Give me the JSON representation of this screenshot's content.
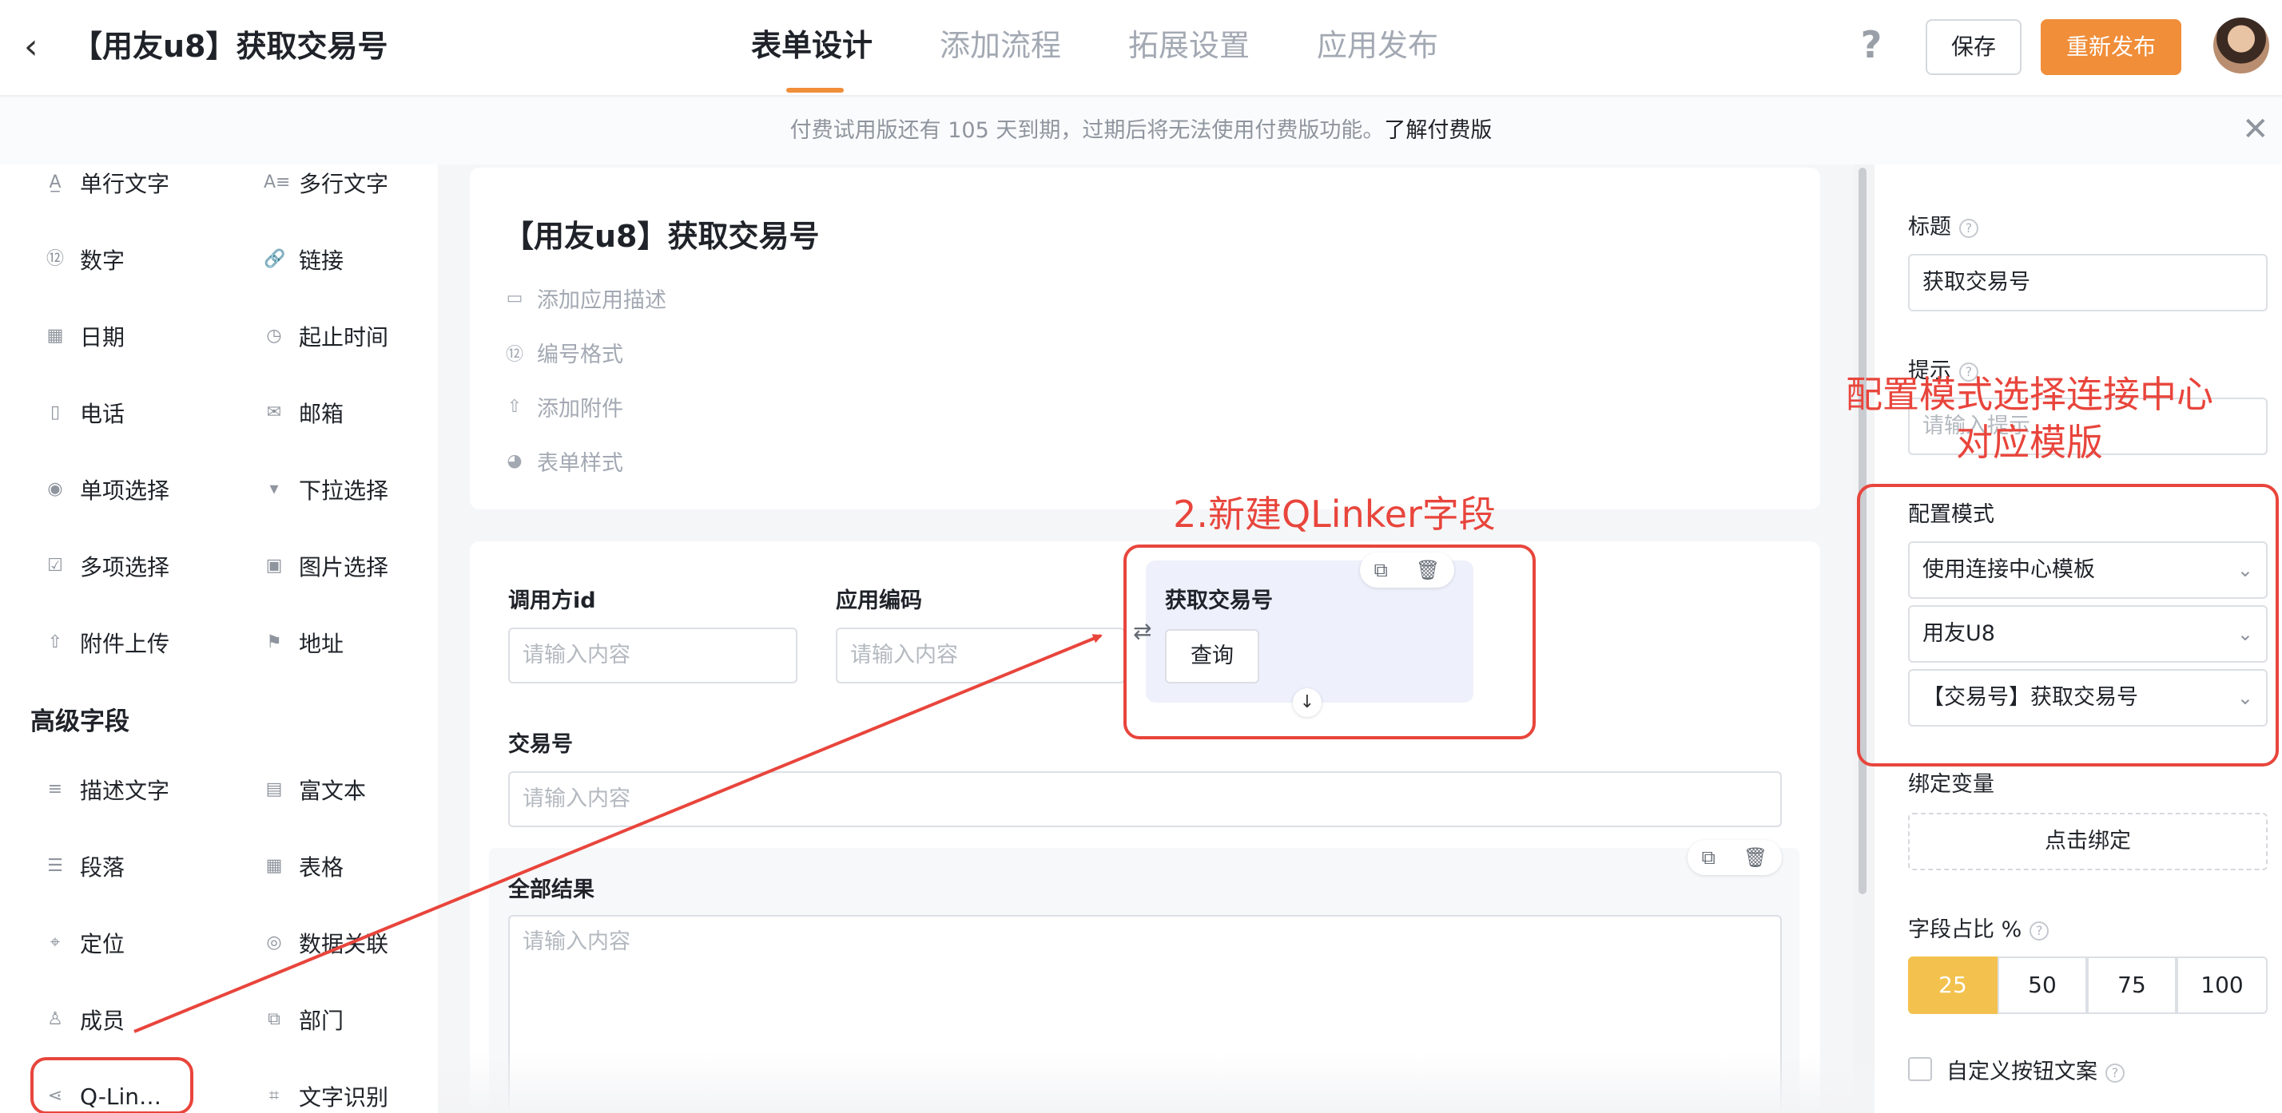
{
  "header": {
    "back_icon": "chevron-left-icon",
    "title": "【用友u8】获取交易号",
    "tabs": [
      {
        "label": "表单设计",
        "active": true
      },
      {
        "label": "添加流程",
        "active": false
      },
      {
        "label": "拓展设置",
        "active": false
      },
      {
        "label": "应用发布",
        "active": false
      }
    ],
    "help_symbol": "?",
    "save_label": "保存",
    "publish_label": "重新发布",
    "accent_color": "#f08e3a"
  },
  "notice": {
    "text": "付费试用版还有 105 天到期，过期后将无法使用付费版功能。",
    "link": "了解付费版",
    "close_symbol": "✕"
  },
  "left_panel": {
    "basic_fields": [
      {
        "label": "单行文字",
        "icon": "single-line-text-icon",
        "glyph": "A̲"
      },
      {
        "label": "多行文字",
        "icon": "multi-line-text-icon",
        "glyph": "A≡"
      },
      {
        "label": "数字",
        "icon": "number-icon",
        "glyph": "⑫"
      },
      {
        "label": "链接",
        "icon": "link-icon",
        "glyph": "🔗"
      },
      {
        "label": "日期",
        "icon": "calendar-icon",
        "glyph": "▦"
      },
      {
        "label": "起止时间",
        "icon": "time-range-icon",
        "glyph": "◷"
      },
      {
        "label": "电话",
        "icon": "phone-icon",
        "glyph": "▯"
      },
      {
        "label": "邮箱",
        "icon": "mail-icon",
        "glyph": "✉"
      },
      {
        "label": "单项选择",
        "icon": "radio-icon",
        "glyph": "◉"
      },
      {
        "label": "下拉选择",
        "icon": "dropdown-icon",
        "glyph": "▾"
      },
      {
        "label": "多项选择",
        "icon": "checkbox-icon",
        "glyph": "☑"
      },
      {
        "label": "图片选择",
        "icon": "image-icon",
        "glyph": "▣"
      },
      {
        "label": "附件上传",
        "icon": "upload-icon",
        "glyph": "⇧"
      },
      {
        "label": "地址",
        "icon": "signpost-icon",
        "glyph": "⚑"
      }
    ],
    "advanced_title": "高级字段",
    "advanced_fields": [
      {
        "label": "描述文字",
        "icon": "description-icon",
        "glyph": "≡"
      },
      {
        "label": "富文本",
        "icon": "rich-text-icon",
        "glyph": "▤"
      },
      {
        "label": "段落",
        "icon": "paragraph-icon",
        "glyph": "☰"
      },
      {
        "label": "表格",
        "icon": "table-icon",
        "glyph": "▦"
      },
      {
        "label": "定位",
        "icon": "location-icon",
        "glyph": "⌖"
      },
      {
        "label": "数据关联",
        "icon": "data-link-icon",
        "glyph": "◎"
      },
      {
        "label": "成员",
        "icon": "member-icon",
        "glyph": "♙"
      },
      {
        "label": "部门",
        "icon": "department-icon",
        "glyph": "⧉"
      },
      {
        "label": "Q-Lin…",
        "icon": "share-nodes-icon",
        "glyph": "⋖"
      },
      {
        "label": "文字识别",
        "icon": "ocr-icon",
        "glyph": "⌗"
      }
    ]
  },
  "form": {
    "title": "【用友u8】获取交易号",
    "meta": [
      {
        "label": "添加应用描述",
        "icon": "comment-icon",
        "glyph": "▭"
      },
      {
        "label": "编号格式",
        "icon": "number-format-icon",
        "glyph": "⑫"
      },
      {
        "label": "添加附件",
        "icon": "upload-icon",
        "glyph": "⇧"
      },
      {
        "label": "表单样式",
        "icon": "palette-icon",
        "glyph": "◕"
      }
    ],
    "fields": {
      "caller_id": {
        "label": "调用方id",
        "placeholder": "请输入内容"
      },
      "app_code": {
        "label": "应用编码",
        "placeholder": "请输入内容"
      },
      "qlinker": {
        "label": "获取交易号",
        "button": "查询"
      },
      "trade_no": {
        "label": "交易号",
        "placeholder": "请输入内容"
      },
      "all_results": {
        "label": "全部结果",
        "placeholder": "请输入内容"
      }
    }
  },
  "right_panel": {
    "title_label": "标题",
    "title_value": "获取交易号",
    "hint_label": "提示",
    "hint_placeholder": "请输入提示",
    "config_label": "配置模式",
    "config_options": [
      "使用连接中心模板",
      "用友U8",
      "【交易号】获取交易号"
    ],
    "bind_label": "绑定变量",
    "bind_button": "点击绑定",
    "ratio_label": "字段占比 %",
    "ratio_options": [
      "25",
      "50",
      "75",
      "100"
    ],
    "ratio_selected": "25",
    "custom_button_label": "自定义按钮文案"
  },
  "annotations": {
    "new_field": "2.新建QLinker字段",
    "config_line1": "配置模式选择连接中心",
    "config_line2": "对应模版",
    "color": "#e8453c"
  }
}
